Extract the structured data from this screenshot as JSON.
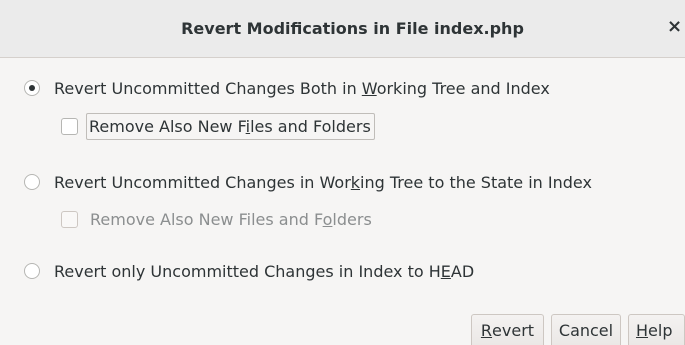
{
  "window": {
    "title": "Revert Modifications in File index.php",
    "close_glyph": "×"
  },
  "options": [
    {
      "pre": "Revert Uncommitted Changes Both in ",
      "mnemonic": "W",
      "post": "orking Tree and Index",
      "selected": true
    },
    {
      "pre": "Revert Uncommitted Changes in Wor",
      "mnemonic": "k",
      "post": "ing Tree to the State in Index",
      "selected": false
    },
    {
      "pre": "Revert only Uncommitted Changes in Index to H",
      "mnemonic": "E",
      "post": "AD",
      "selected": false
    }
  ],
  "checkboxes": [
    {
      "pre": "Remove Also New F",
      "mnemonic": "i",
      "post": "les and Folders",
      "checked": false,
      "enabled": true
    },
    {
      "pre": "Remove Also New Files and F",
      "mnemonic": "o",
      "post": "lders",
      "checked": false,
      "enabled": false
    }
  ],
  "buttons": {
    "revert": {
      "mnemonic": "R",
      "post": "evert"
    },
    "cancel": {
      "label": "Cancel"
    },
    "help": {
      "mnemonic": "H",
      "post": "elp"
    }
  }
}
